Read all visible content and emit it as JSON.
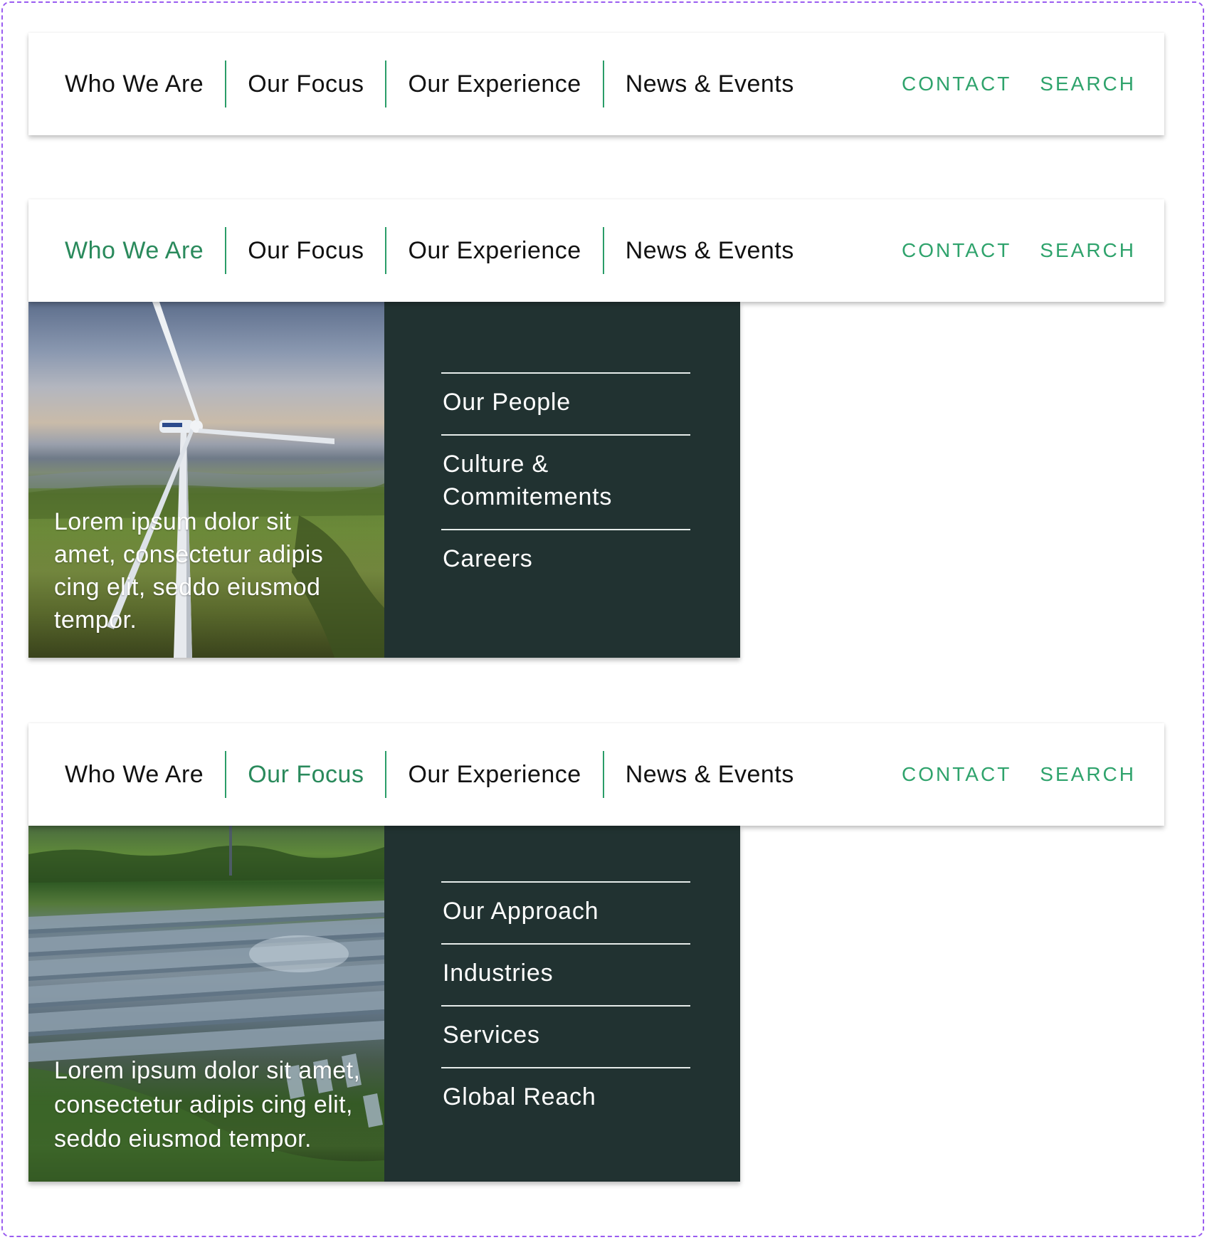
{
  "nav": {
    "items": [
      "Who We Are",
      "Our Focus",
      "Our Experience",
      "News & Events"
    ],
    "contact": "CONTACT",
    "search": "SEARCH"
  },
  "colors": {
    "accent_green": "#2fa36c",
    "active_green": "#2a8a5c",
    "panel_dark": "#213231",
    "frame_dashed": "#9a5cf0"
  },
  "state_who": {
    "active_item": "Who We Are",
    "caption": "Lorem ipsum dolor sit amet, consectetur adipis cing elit, seddo eiusmod tempor.",
    "links": [
      "Our People",
      "Culture & Commitements",
      "Careers"
    ]
  },
  "state_focus": {
    "active_item": "Our Focus",
    "caption": "Lorem ipsum dolor sit amet, consectetur adipis cing elit, seddo eiusmod tempor.",
    "links": [
      "Our Approach",
      "Industries",
      "Services",
      "Global Reach"
    ]
  }
}
